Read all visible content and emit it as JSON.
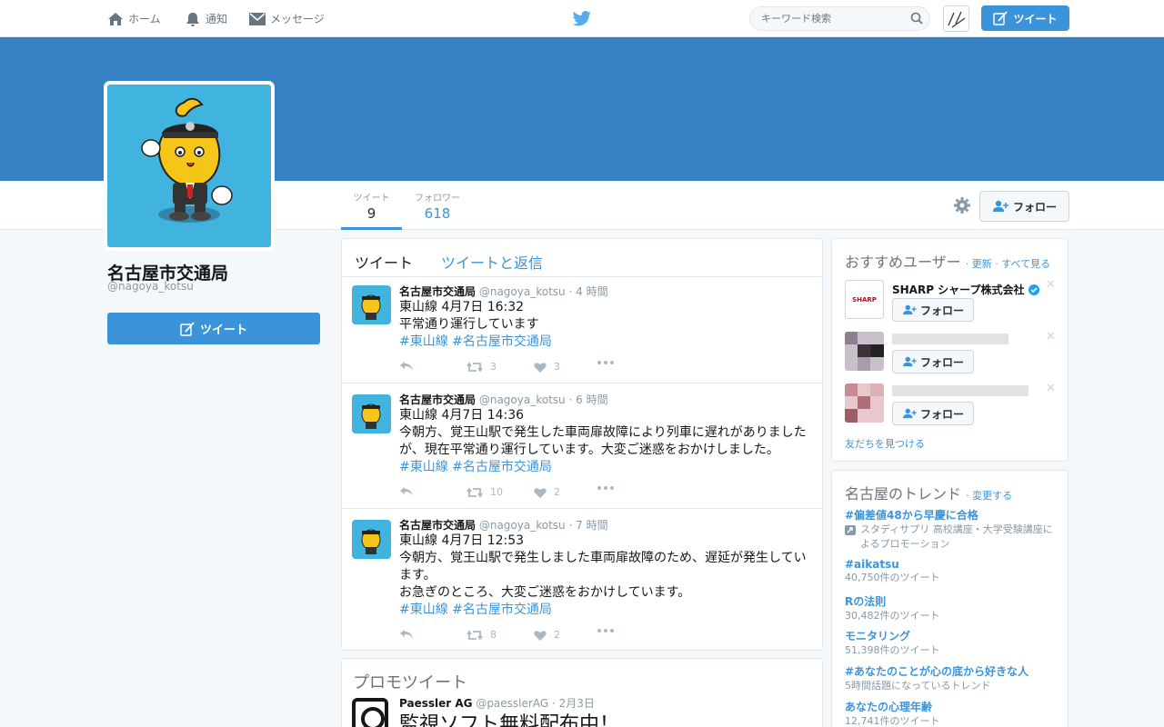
{
  "nav": {
    "home": "ホーム",
    "notifications": "通知",
    "messages": "メッセージ",
    "search_placeholder": "キーワード検索",
    "tweet_button": "ツイート"
  },
  "profile": {
    "name": "名古屋市交通局",
    "handle": "@nagoya_kotsu",
    "stats": [
      {
        "label": "ツイート",
        "value": "9"
      },
      {
        "label": "フォロワー",
        "value": "618"
      }
    ],
    "follow_button": "フォロー",
    "side_tweet_button": "ツイート"
  },
  "timeline": {
    "tabs": [
      "ツイート",
      "ツイートと返信"
    ],
    "tweets": [
      {
        "name": "名古屋市交通局",
        "handle": "@nagoya_kotsu",
        "time": "· 4 時間",
        "lines": [
          "東山線 4月7日 16:32",
          "平常通り運行しています"
        ],
        "tags": "#東山線 #名古屋市交通局",
        "retweets": "3",
        "likes": "3"
      },
      {
        "name": "名古屋市交通局",
        "handle": "@nagoya_kotsu",
        "time": "· 6 時間",
        "lines": [
          "東山線 4月7日 14:36",
          "今朝方、覚王山駅で発生した車両扉故障により列車に遅れがありましたが、現在平常通り運行しています。大変ご迷惑をおかけしました。"
        ],
        "tags": "#東山線 #名古屋市交通局",
        "retweets": "10",
        "likes": "2"
      },
      {
        "name": "名古屋市交通局",
        "handle": "@nagoya_kotsu",
        "time": "· 7 時間",
        "lines": [
          "東山線 4月7日 12:53",
          "今朝方、覚王山駅で発生しました車両扉故障のため、遅延が発生しています。",
          "お急ぎのところ、大変ご迷惑をおかけしています。"
        ],
        "tags": "#東山線 #名古屋市交通局",
        "retweets": "8",
        "likes": "2"
      }
    ]
  },
  "promo": {
    "title": "プロモツイート",
    "name": "Paessler AG",
    "handle": "@paesslerAG",
    "time": "· 2月3日",
    "text": "監視ソフト無料配布中！"
  },
  "who_to_follow": {
    "title": "おすすめユーザー",
    "refresh": "更新",
    "see_all": "すべて見る",
    "sep": "·",
    "users": [
      {
        "name": "SHARP シャープ株式会社",
        "logo": "SHARP",
        "follow": "フォロー"
      },
      {
        "name": "",
        "follow": "フォロー"
      },
      {
        "name": "",
        "follow": "フォロー"
      }
    ],
    "find_friends": "友だちを見つける"
  },
  "trends": {
    "title": "名古屋のトレンド",
    "change": "変更する",
    "items": [
      {
        "tag": "#偏差値48から早慶に合格",
        "sub": "スタディサプリ 高校講座・大学受験講座によるプロモーション"
      },
      {
        "tag": "#aikatsu",
        "sub": "40,750件のツイート"
      },
      {
        "tag": "Rの法則",
        "sub": "30,482件のツイート"
      },
      {
        "tag": "モニタリング",
        "sub": "51,398件のツイート"
      },
      {
        "tag": "#あなたのことが心の底から好きな人",
        "sub": "5時間話題になっているトレンド"
      },
      {
        "tag": "あなたの心理年齢",
        "sub": "12,741件のツイート"
      }
    ]
  },
  "colors": {
    "accent": "#3b94d9",
    "banner": "#3680c4",
    "avatar_bg": "#40b4df"
  }
}
